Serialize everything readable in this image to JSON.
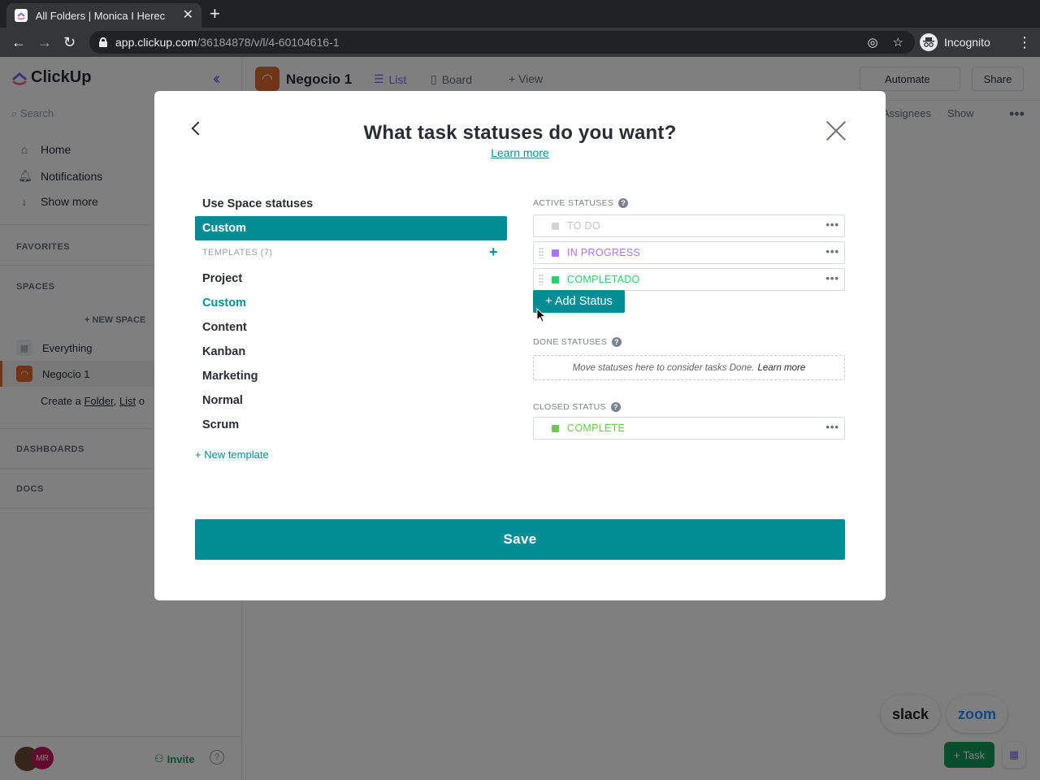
{
  "browser": {
    "tab_title": "All Folders | Monica I Herec",
    "url_host": "app.clickup.com",
    "url_path": "/36184878/v/l/4-60104616-1",
    "profile_label": "Incognito"
  },
  "sidebar": {
    "logo": "ClickUp",
    "search_placeholder": "Search",
    "nav": [
      {
        "label": "Home",
        "icon": "home-icon"
      },
      {
        "label": "Notifications",
        "icon": "bell-icon"
      },
      {
        "label": "Show more",
        "icon": "arrow-down-icon"
      }
    ],
    "sections": {
      "favorites": "FAVORITES",
      "spaces": "SPACES",
      "dashboards": "DASHBOARDS",
      "docs": "DOCS"
    },
    "new_space": "+ NEW SPACE",
    "spaces": [
      {
        "label": "Everything"
      },
      {
        "label": "Negocio 1",
        "active": true
      }
    ],
    "create_prefix": "Create a ",
    "create_folder": "Folder",
    "create_sep": ", ",
    "create_list": "List",
    "create_suffix": " o",
    "avatar_initials": "MR",
    "invite": "Invite",
    "help": "?"
  },
  "topbar": {
    "project": "Negocio 1",
    "views": [
      {
        "label": "List",
        "active": true
      },
      {
        "label": "Board"
      },
      {
        "label": "+ View"
      }
    ],
    "automate": "Automate",
    "share": "Share",
    "assignees": "Assignees",
    "show": "Show"
  },
  "floating": {
    "slack": "slack",
    "zoom": "zoom",
    "task": "Task"
  },
  "modal": {
    "title": "What task statuses do you want?",
    "learn_more": "Learn more",
    "left": {
      "use_space": "Use Space statuses",
      "custom_selected": "Custom",
      "templates_header": "TEMPLATES (7)",
      "templates": [
        "Project",
        "Custom",
        "Content",
        "Kanban",
        "Marketing",
        "Normal",
        "Scrum"
      ],
      "new_template": "+ New template"
    },
    "right": {
      "active_label": "ACTIVE STATUSES",
      "active": [
        {
          "name": "TO DO",
          "color": "#d3d3d3",
          "text_color": "#c4c4c4"
        },
        {
          "name": "IN PROGRESS",
          "color": "#a875ff",
          "text_color": "#a875ff"
        },
        {
          "name": "COMPLETADO",
          "color": "#2ecd6f",
          "text_color": "#2ecd6f"
        }
      ],
      "add_status": "+ Add Status",
      "done_label": "DONE STATUSES",
      "done_hint": "Move statuses here to consider tasks Done.",
      "done_learn_more": "Learn more",
      "closed_label": "CLOSED STATUS",
      "closed": {
        "name": "COMPLETE",
        "color": "#6bc950",
        "text_color": "#6bc950"
      }
    },
    "save": "Save"
  },
  "colors": {
    "accent": "#008e94",
    "clickup_purple": "#7b68ee",
    "space_orange": "#e06a2e"
  }
}
